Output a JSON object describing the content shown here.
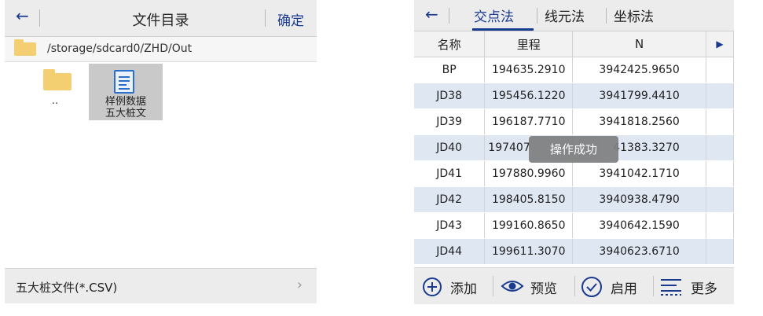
{
  "file_dialog": {
    "title": "文件目录",
    "confirm_label": "确定",
    "path": "/storage/sdcard0/ZHD/Out",
    "items": [
      {
        "label": ".."
      },
      {
        "label_line1": "样例数据",
        "label_line2": "五大桩文"
      }
    ],
    "filter_label": "五大桩文件(*.CSV)"
  },
  "table_view": {
    "tabs": [
      "交点法",
      "线元法",
      "坐标法"
    ],
    "active_tab": "交点法",
    "columns": [
      "名称",
      "里程",
      "N"
    ],
    "rows": [
      {
        "name": "BP",
        "mileage": "194635.2910",
        "n": "3942425.9650"
      },
      {
        "name": "JD38",
        "mileage": "195456.1220",
        "n": "3941799.4410"
      },
      {
        "name": "JD39",
        "mileage": "196187.7710",
        "n": "3941818.2560"
      },
      {
        "name": "JD40",
        "mileage": "197407",
        "n": "41383.3270"
      },
      {
        "name": "JD41",
        "mileage": "197880.9960",
        "n": "3941042.1710"
      },
      {
        "name": "JD42",
        "mileage": "198405.8150",
        "n": "3940938.4790"
      },
      {
        "name": "JD43",
        "mileage": "199160.8650",
        "n": "3940642.1590"
      },
      {
        "name": "JD44",
        "mileage": "199611.3070",
        "n": "3940623.6710"
      }
    ],
    "toast": "操作成功",
    "footer": {
      "add": "添加",
      "preview": "预览",
      "enable": "启用",
      "more": "更多"
    }
  },
  "colors": {
    "accent": "#1a3a8f",
    "row_alt": "#dfe7f3",
    "folder": "#f4cf72"
  }
}
